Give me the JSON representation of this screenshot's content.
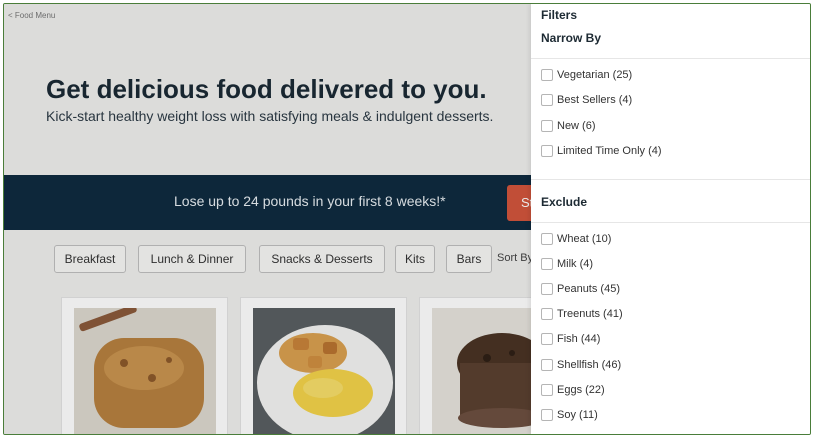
{
  "breadcrumb": "< Food Menu",
  "hero": {
    "title": "Get delicious food delivered to you.",
    "subtitle": "Kick-start healthy weight loss with satisfying meals & indulgent desserts."
  },
  "promo": {
    "text": "Lose up to 24 pounds in your first 8 weeks!*",
    "button_label": "St"
  },
  "categories": [
    "Breakfast",
    "Lunch & Dinner",
    "Snacks & Desserts",
    "Kits",
    "Bars"
  ],
  "sort_label": "Sort By",
  "filters": {
    "title": "Filters",
    "narrow_by": {
      "title": "Narrow By",
      "options": [
        "Vegetarian (25)",
        "Best Sellers (4)",
        "New (6)",
        "Limited Time Only (4)"
      ]
    },
    "exclude": {
      "title": "Exclude",
      "options": [
        "Wheat (10)",
        "Milk (4)",
        "Peanuts (45)",
        "Treenuts (41)",
        "Fish (44)",
        "Shellfish (46)",
        "Eggs (22)",
        "Soy (11)"
      ]
    }
  },
  "colors": {
    "promo_bg": "#0f2b3f",
    "promo_button": "#d2553c",
    "frame_border": "#4a7d3a"
  }
}
